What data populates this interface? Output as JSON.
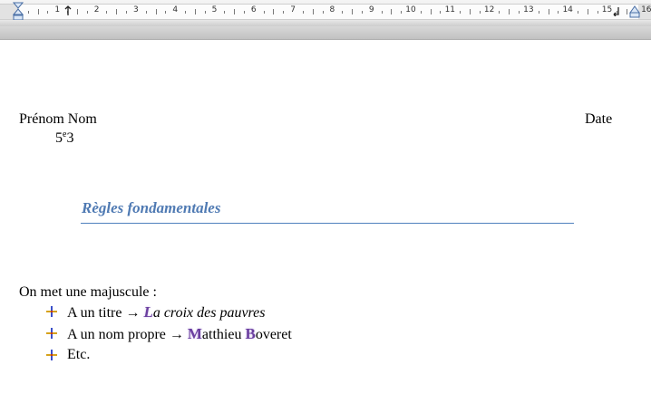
{
  "ruler": {
    "numbers": [
      "1",
      "2",
      "3",
      "4",
      "5",
      "6",
      "7",
      "8",
      "9",
      "10",
      "11",
      "12",
      "13",
      "14",
      "15",
      "16"
    ]
  },
  "document": {
    "name_label": "Prénom Nom",
    "date_label": "Date",
    "class_prefix": "5",
    "class_sup": "e",
    "class_suffix": "3",
    "title": "Règles fondamentales",
    "intro": "On met une majuscule :",
    "bullets": [
      {
        "prefix": "A un titre ",
        "arrow": "→",
        "cap1": "L",
        "rest1": "a croix des pauvres"
      },
      {
        "prefix": "A un nom propre ",
        "arrow": "→",
        "cap1": "M",
        "rest1": "atthieu ",
        "cap2": "B",
        "rest2": "overet"
      },
      {
        "prefix": "Etc."
      }
    ]
  },
  "colors": {
    "title": "#4f7ab3",
    "title_rule": "#4f81bd",
    "capital_highlight": "#6b3fa0"
  }
}
